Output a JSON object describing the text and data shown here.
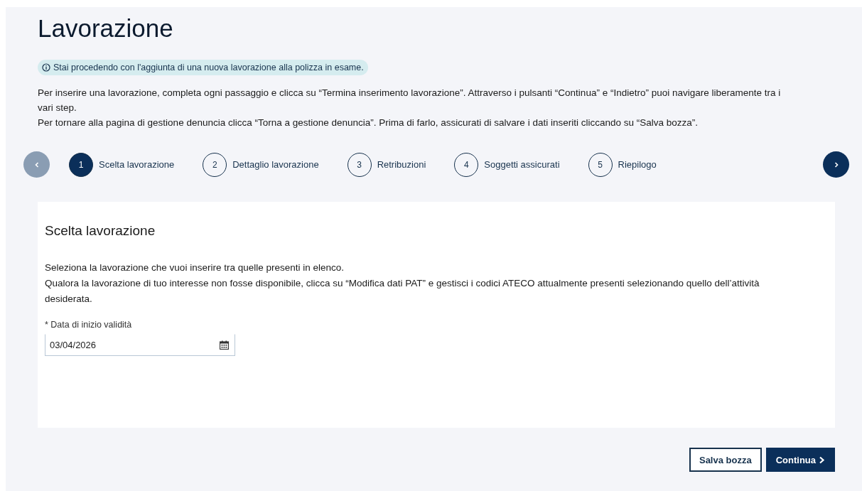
{
  "page": {
    "title": "Lavorazione"
  },
  "notice": "Stai procedendo con l'aggiunta di una nuova lavorazione alla polizza in esame.",
  "intro": [
    "Per inserire una lavorazione, completa ogni passaggio e clicca su “Termina inserimento lavorazione”. Attraverso i pulsanti “Continua” e “Indietro” puoi navigare liberamente tra i vari step.",
    "Per tornare alla pagina di gestione denuncia clicca “Torna a gestione denuncia”. Prima di farlo, assicurati di salvare i dati inseriti cliccando su “Salva bozza”."
  ],
  "stepper": {
    "prev_disabled": true,
    "next_disabled": false,
    "steps": [
      {
        "number": "1",
        "label": "Scelta lavorazione",
        "selected": true
      },
      {
        "number": "2",
        "label": "Dettaglio lavorazione",
        "selected": false
      },
      {
        "number": "3",
        "label": "Retribuzioni",
        "selected": false
      },
      {
        "number": "4",
        "label": "Soggetti assicurati",
        "selected": false
      },
      {
        "number": "5",
        "label": "Riepilogo",
        "selected": false
      }
    ]
  },
  "card": {
    "title": "Scelta lavorazione",
    "description": [
      "Seleziona la lavorazione che vuoi inserire tra quelle presenti in elenco.",
      "Qualora la lavorazione di tuo interesse non fosse disponibile, clicca su “Modifica dati PAT” e gestisci i codici ATECO attualmente presenti selezionando quello dell’attività desiderata."
    ],
    "date_field": {
      "label": "* Data di inizio validità",
      "value": "03/04/2026"
    }
  },
  "buttons": [
    {
      "label": "Salva bozza",
      "kind": "secondary"
    },
    {
      "label": "Continua",
      "kind": "primary"
    }
  ]
}
